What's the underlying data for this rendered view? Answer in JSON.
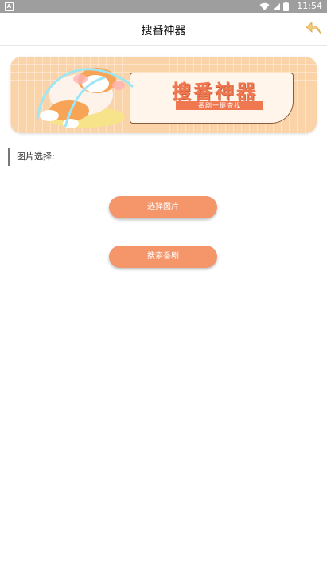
{
  "status_bar": {
    "time": "11:54",
    "left_icon_letter": "A",
    "icons": [
      "wifi-icon",
      "signal-icon",
      "battery-icon"
    ]
  },
  "app_bar": {
    "title": "搜番神器",
    "back_icon": "back-arrow-icon"
  },
  "banner": {
    "title": "搜番神器",
    "subtitle": "番剧一键查找"
  },
  "section": {
    "label": "图片选择:"
  },
  "buttons": {
    "select_image": "选择图片",
    "search_anime": "搜索番剧"
  },
  "colors": {
    "accent": "#f4956a",
    "banner_bg": "#fbd3a8",
    "banner_title": "#f07850",
    "status_bar": "#9e9e9e"
  }
}
